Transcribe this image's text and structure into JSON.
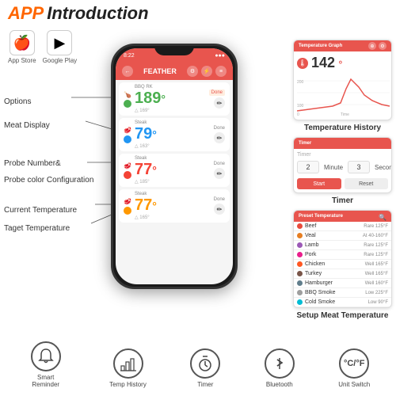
{
  "header": {
    "app_text": "APP",
    "intro_text": "Introduction"
  },
  "stores": [
    {
      "label": "App Store",
      "icon": "🍎"
    },
    {
      "label": "Google Play",
      "icon": "▶"
    }
  ],
  "labels": [
    {
      "id": "options",
      "text": "Options"
    },
    {
      "id": "meat_display",
      "text": "Meat Display"
    },
    {
      "id": "probe_number",
      "text": "Probe Number&\nProbe color Configuration"
    },
    {
      "id": "current_temp",
      "text": "Current Temperature"
    },
    {
      "id": "target_temp",
      "text": "Taget Temperature"
    }
  ],
  "phone": {
    "status": "8:22",
    "title": "FEATHER",
    "probes": [
      {
        "color": "#4CAF50",
        "name": "BBQ RK",
        "temp": "189",
        "unit": "°",
        "target": "△ 169°",
        "done": "Done",
        "type": "chicken"
      },
      {
        "color": "#2196F3",
        "name": "Steak",
        "temp": "79",
        "unit": "°",
        "target": "△ 163°",
        "done": "Done",
        "type": "meat"
      },
      {
        "color": "#F44336",
        "name": "Steak",
        "temp": "77",
        "unit": "°",
        "target": "△ 185°",
        "done": "Done",
        "type": "meat"
      },
      {
        "color": "#FF9800",
        "name": "Steak",
        "temp": "77",
        "unit": "°",
        "target": "△ 165°",
        "done": "Done",
        "type": "meat"
      }
    ]
  },
  "screenshots": {
    "temp_history": {
      "header": "Temperature Graph",
      "temp_display": "142°",
      "label": "Temperature History"
    },
    "timer": {
      "header": "Timer",
      "label": "Timer",
      "minute_label": "Minute",
      "second_label": "Second",
      "minute_value": "2",
      "second_value": "3"
    },
    "preset": {
      "header": "Preset Temperature",
      "label": "Setup Meat Temperature",
      "items": [
        {
          "name": "Beef",
          "color": "#e74c3c",
          "temps": "Rare 125°F"
        },
        {
          "name": "Veal",
          "color": "#e67e22",
          "temps": "At 40 - 160°F"
        },
        {
          "name": "Lamb",
          "color": "#9b59b6",
          "temps": "Rare 125°F"
        },
        {
          "name": "Pork",
          "color": "#e91e8c",
          "temps": "Rare 125°F"
        },
        {
          "name": "Chicken",
          "color": "#ff5722",
          "temps": "Well 165°F"
        },
        {
          "name": "Turkey",
          "color": "#795548",
          "temps": "Well 165°F"
        },
        {
          "name": "Hamburger",
          "color": "#607d8b",
          "temps": "Well 160°F"
        },
        {
          "name": "BBQ Smoke",
          "color": "#9e9e9e",
          "temps": "Low 225°F"
        },
        {
          "name": "Cold Smoke",
          "color": "#00bcd4",
          "temps": "Low 90°F"
        }
      ]
    }
  },
  "bottom_icons": [
    {
      "id": "smart_reminder",
      "label": "Smart Reminder",
      "icon": "🔔"
    },
    {
      "id": "temp_history",
      "label": "Temp History",
      "icon": "📊"
    },
    {
      "id": "timer",
      "label": "Timer",
      "icon": "⏱"
    },
    {
      "id": "bluetooth",
      "label": "Bluetooth",
      "icon": "⚡"
    },
    {
      "id": "unit_switch",
      "label": "Unit Switch",
      "icon": "°C/°F"
    }
  ]
}
